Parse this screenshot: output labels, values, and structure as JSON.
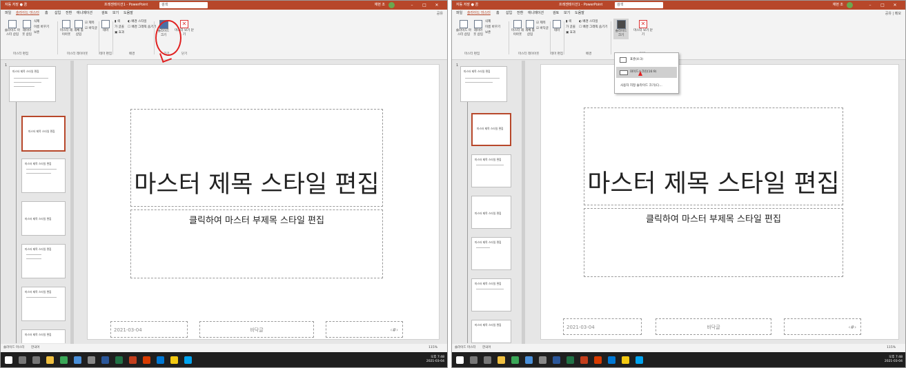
{
  "app": {
    "autosave": "자동 저장 ● 끔",
    "filename": "프레젠테이션1 - PowerPoint",
    "search": "검색",
    "user": "재현 조",
    "share": "공유",
    "share_right": "공유 | 메모"
  },
  "tabs": [
    "파일",
    "슬라이드 마스터",
    "홈",
    "삽입",
    "전환",
    "애니메이션",
    "검토",
    "보기",
    "도움말"
  ],
  "ribbon": {
    "insert_master": "슬라이드 마스터 삽입",
    "insert_layout": "레이아웃 삽입",
    "delete": "삭제",
    "rename": "이름 바꾸기",
    "preserve": "보존",
    "master_layout": "마스터 레이아웃",
    "insert_placeholder": "개체 틀 삽입",
    "title_check": "제목",
    "footer_check": "바닥글",
    "themes": "테마",
    "colors": "색",
    "fonts": "글꼴",
    "effects": "효과",
    "bg_styles": "배경 스타일",
    "hide_bg": "배경 그래픽 숨기기",
    "slide_size": "슬라이드 크기",
    "close_master": "마스터 보기 닫기",
    "g_edit_master": "마스터 편집",
    "g_master_layout": "마스터 레이아웃",
    "g_edit_theme": "테마 편집",
    "g_background": "배경",
    "g_size": "크기",
    "g_close": "닫기"
  },
  "slide": {
    "title": "마스터 제목 스타일 편집",
    "subtitle": "클릭하여 마스터 부제목 스타일 편집",
    "date": "2021-03-04",
    "footer": "바닥글",
    "page": "‹#›"
  },
  "thumbnails": {
    "number": "1",
    "items": [
      "마스터 제목 스타일 편집",
      "마스터 제목 스타일 편집",
      "마스터 제목 스타일 편집",
      "마스터 제목 스타일 편집",
      "마스터 제목 스타일 편집",
      "마스터 제목 스타일 편집",
      "마스터 제목 스타일 편집"
    ]
  },
  "dropdown": {
    "standard": "표준(4:3)",
    "widescreen": "와이드스크린(16:9)",
    "custom": "사용자 지정 슬라이드 크기(C)..."
  },
  "status": {
    "view": "슬라이드 마스터",
    "lang": "한국어",
    "zoom": "115%"
  },
  "clock": {
    "time": "오후 7:48",
    "date": "2021-03-04"
  },
  "colors": {
    "accent": "#b7472a",
    "annotation": "#e02020"
  }
}
